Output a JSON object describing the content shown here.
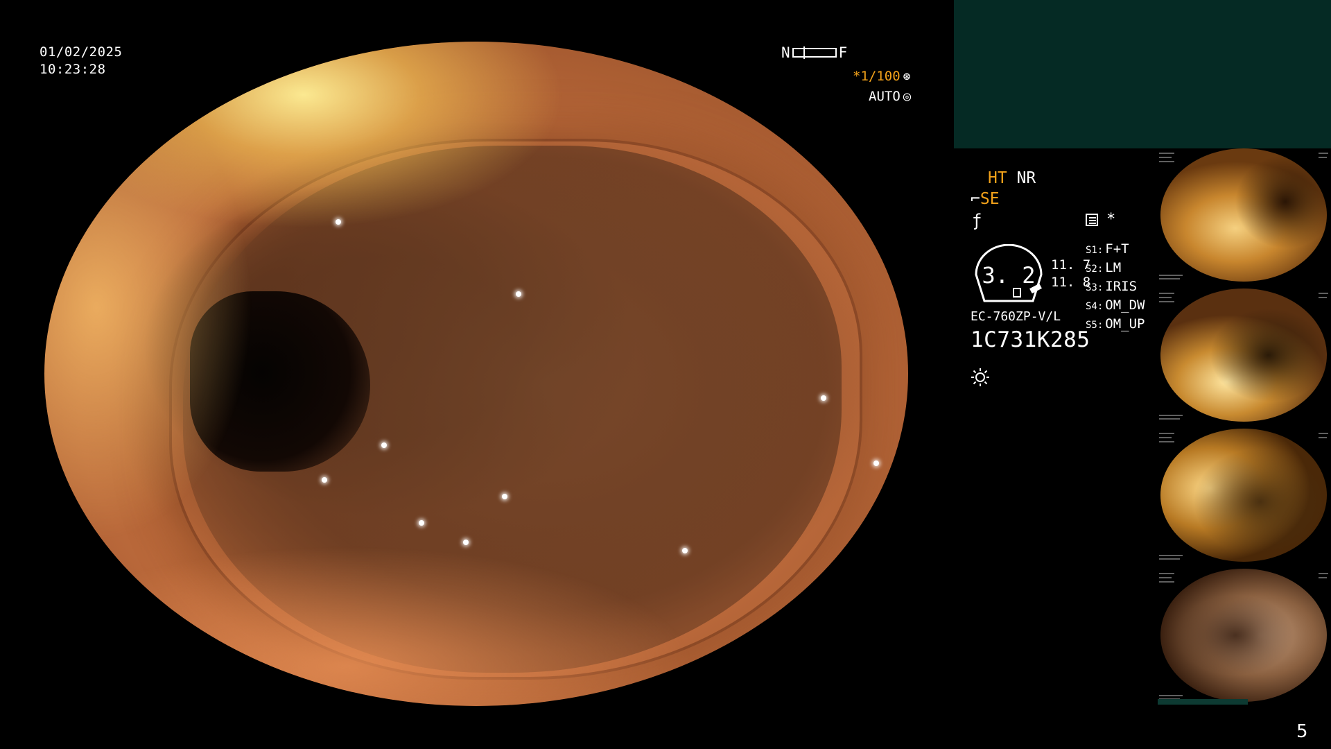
{
  "overlay": {
    "date": "01/02/2025",
    "time": "10:23:28",
    "nf_left": "N",
    "nf_right": "F",
    "shutter": "*1/100",
    "auto": "AUTO"
  },
  "modes": {
    "ht": "HT",
    "nr": "NR",
    "se": "SE"
  },
  "gauge": {
    "value": "3. 2",
    "upper": "11. 7",
    "lower": "11. 8"
  },
  "scope": {
    "model": "EC-760ZP-V/L",
    "serial": "1C731K285"
  },
  "switches": [
    {
      "key": "S1:",
      "value": "F+T"
    },
    {
      "key": "S2:",
      "value": "LM"
    },
    {
      "key": "S3:",
      "value": "IRIS"
    },
    {
      "key": "S4:",
      "value": "OM_DW"
    },
    {
      "key": "S5:",
      "value": "OM_UP"
    }
  ],
  "page_number": "5",
  "colors": {
    "amber": "#f3a21a",
    "teal_panel": "#052a24",
    "background": "#000000"
  },
  "icons": {
    "shutter": "aperture-icon",
    "auto": "target-icon",
    "structure": "structure-enhance-icon",
    "light": "light-source-icon"
  }
}
